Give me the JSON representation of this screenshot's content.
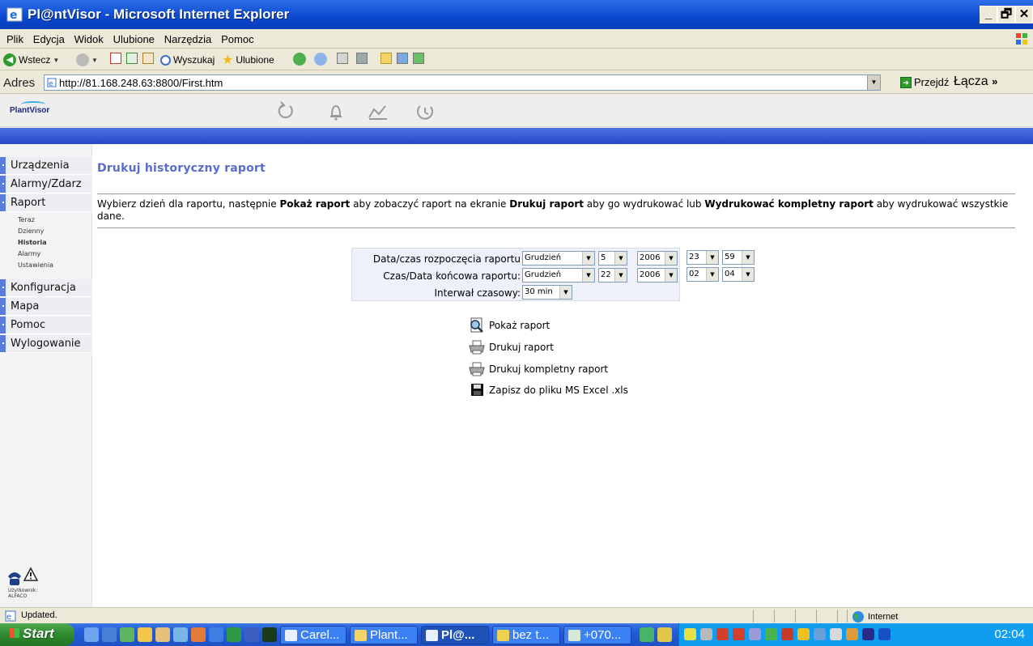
{
  "window": {
    "title": "Pl@ntVisor - Microsoft Internet Explorer",
    "controls": {
      "minimize": "_",
      "maximize": "🗗",
      "close": "✕"
    }
  },
  "menubar": [
    "Plik",
    "Edycja",
    "Widok",
    "Ulubione",
    "Narzędzia",
    "Pomoc"
  ],
  "toolbar": {
    "back_label": "Wstecz",
    "search_label": "Wyszukaj",
    "favorites_label": "Ulubione"
  },
  "address": {
    "label": "Adres",
    "url": "http://81.168.248.63:8800/First.htm",
    "go_label": "Przejdź",
    "links_label": "Łącza",
    "links_more": "»"
  },
  "app": {
    "logo_text": "PlantVisor",
    "header_icons": [
      "refresh-icon",
      "alarm-bell-icon",
      "trend-chart-icon",
      "clock-icon"
    ]
  },
  "sidebar": {
    "items": [
      {
        "label": "Urządzenia"
      },
      {
        "label": "Alarmy/Zdarz"
      },
      {
        "label": "Raport"
      },
      {
        "label": "Konfiguracja"
      },
      {
        "label": "Mapa"
      },
      {
        "label": "Pomoc"
      },
      {
        "label": "Wylogowanie"
      }
    ],
    "subitems": [
      {
        "label": "Teraz",
        "active": false
      },
      {
        "label": "Dzienny",
        "active": false
      },
      {
        "label": "Historia",
        "active": true
      },
      {
        "label": "Alarmy",
        "active": false
      },
      {
        "label": "Ustawienia",
        "active": false
      }
    ],
    "user_label": "Użytkownik:",
    "user_name": "ALFACO"
  },
  "main": {
    "heading": "Drukuj historyczny raport",
    "desc": {
      "t1": "Wybierz dzień dla raportu, następnie ",
      "b1": "Pokaż raport",
      "t2": " aby zobaczyć raport na ekranie ",
      "b2": "Drukuj raport",
      "t3": " aby go wydrukować lub ",
      "b3": "Wydrukować kompletny raport",
      "t4": " aby wydrukować wszystkie dane."
    },
    "form": {
      "start_label": "Data/czas rozpoczęcia raportu",
      "start": {
        "month": "Grudzień",
        "day": "5",
        "year": "2006",
        "hour": "23",
        "minute": "59"
      },
      "end_label": "Czas/Data końcowa raportu:",
      "end": {
        "month": "Grudzień",
        "day": "22",
        "year": "2006",
        "hour": "02",
        "minute": "04"
      },
      "interval_label": "Interwał czasowy:",
      "interval": "30 min"
    },
    "actions": {
      "show": "Pokaż raport",
      "print": "Drukuj raport",
      "print_full": "Drukuj kompletny raport",
      "excel": "Zapisz do pliku MS Excel .xls"
    }
  },
  "statusbar": {
    "text": "Updated.",
    "zone": "Internet"
  },
  "taskbar": {
    "start": "Start",
    "tasks": [
      {
        "label": "Carel...",
        "active": false
      },
      {
        "label": "Plant...",
        "active": false
      },
      {
        "label": "Pl@...",
        "active": true
      },
      {
        "label": "bez t...",
        "active": false
      },
      {
        "label": "+070...",
        "active": false
      }
    ],
    "clock": "02:04"
  },
  "colors": {
    "title_bar": "#0a48cf",
    "app_blue_bar": "#2848c8",
    "heading": "#5a6ccc",
    "nav_bullet": "#5b7cdc",
    "form_bg": "#eef0fa"
  }
}
